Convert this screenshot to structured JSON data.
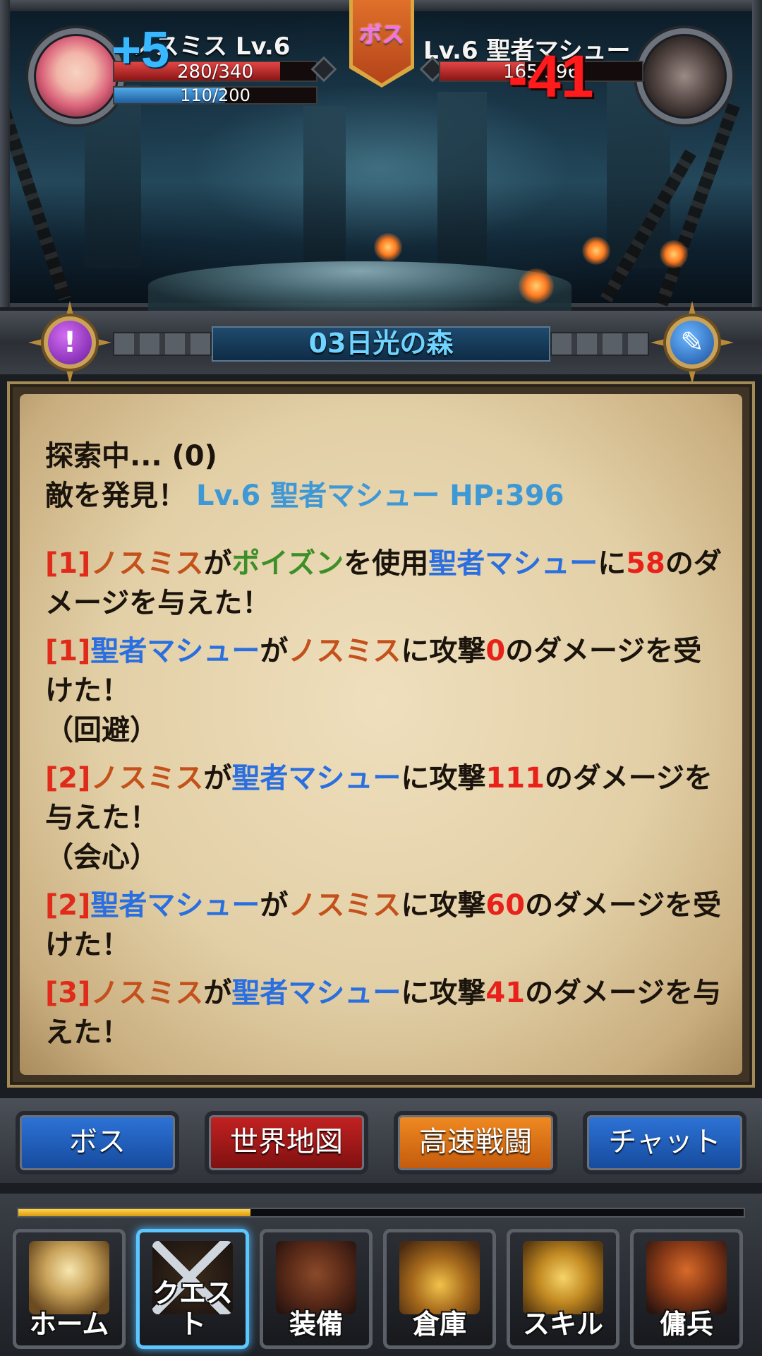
{
  "battle": {
    "player": {
      "name_level": "ノスミス Lv.6",
      "hp_text": "280/340",
      "hp_fraction": 0.82,
      "mp_text": "110/200",
      "mp_fraction": 0.55,
      "floating_heal": "+5"
    },
    "boss_label": "ボス",
    "enemy": {
      "name_level": "Lv.6 聖者マシュー",
      "hp_text": "165/396",
      "hp_fraction": 0.42,
      "floating_damage": "-41"
    }
  },
  "stage": {
    "title": "03日光の森"
  },
  "log": {
    "status_line": "探索中... (0)",
    "found_prefix": "敵を発見！",
    "found_enemy": "Lv.6 聖者マシュー HP:396",
    "entries": [
      {
        "turn": "[1]",
        "actor": "ノスミス",
        "p1": "が",
        "skill": "ポイズン",
        "p2": "を使用",
        "target": "聖者マシュー",
        "p3": "に",
        "num": "58",
        "p4": "のダメージを与えた！"
      },
      {
        "turn": "[1]",
        "actor": "聖者マシュー",
        "p1": "が",
        "target": "ノスミス",
        "p2": "に攻撃",
        "num": "0",
        "p3": "のダメージを受けた！",
        "note": "（回避）"
      },
      {
        "turn": "[2]",
        "actor": "ノスミス",
        "p1": "が",
        "target": "聖者マシュー",
        "p2": "に攻撃",
        "num": "111",
        "p3": "のダメージを与えた！",
        "note": "（会心）"
      },
      {
        "turn": "[2]",
        "actor": "聖者マシュー",
        "p1": "が",
        "target": "ノスミス",
        "p2": "に攻撃",
        "num": "60",
        "p3": "のダメージを受けた！"
      },
      {
        "turn": "[3]",
        "actor": "ノスミス",
        "p1": "が",
        "target": "聖者マシュー",
        "p2": "に攻撃",
        "num": "41",
        "p3": "のダメージを与えた！"
      }
    ]
  },
  "actions": {
    "boss": "ボス",
    "world_map": "世界地図",
    "fast_battle": "高速戦闘",
    "chat": "チャット"
  },
  "nav": {
    "progress_fraction": 0.32,
    "items": [
      {
        "label": "ホーム",
        "icon": "home-shield-icon"
      },
      {
        "label": "クエスト",
        "icon": "crossed-swords-icon"
      },
      {
        "label": "装備",
        "icon": "armor-icon"
      },
      {
        "label": "倉庫",
        "icon": "treasure-chest-icon"
      },
      {
        "label": "スキル",
        "icon": "spellbook-icon"
      },
      {
        "label": "傭兵",
        "icon": "hooded-mercenary-icon"
      }
    ]
  },
  "colors": {
    "player_name": "#c4511c",
    "enemy_name": "#2a6fe0",
    "skill": "#3d8f27",
    "damage_number": "#e8221a",
    "turn_marker": "#e02b1a"
  }
}
